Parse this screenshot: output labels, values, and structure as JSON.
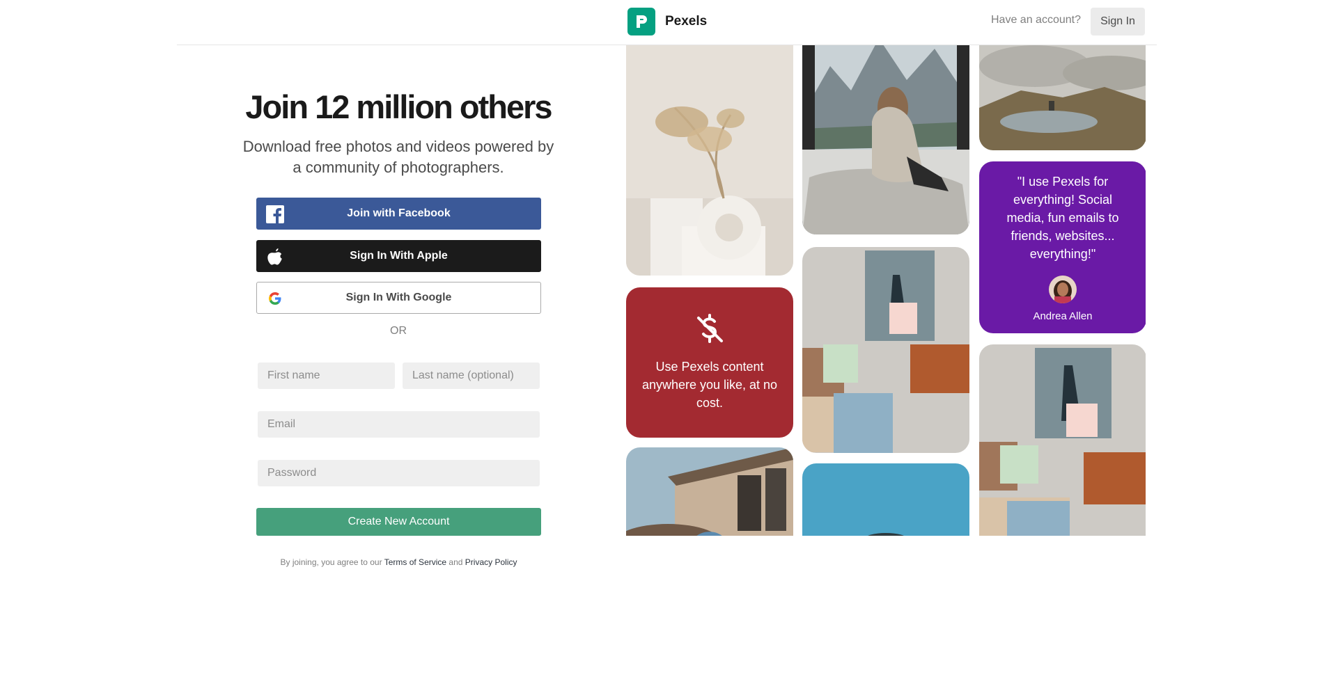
{
  "header": {
    "brand": "Pexels",
    "have_account": "Have an account?",
    "sign_in": "Sign In"
  },
  "hero": {
    "title": "Join 12 million others",
    "subtitle": "Download free photos and videos powered by a community of photographers."
  },
  "social": {
    "facebook": "Join with Facebook",
    "apple": "Sign In With Apple",
    "google": "Sign In With Google"
  },
  "or_label": "OR",
  "form": {
    "first_name_placeholder": "First name",
    "last_name_placeholder": "Last name (optional)",
    "email_placeholder": "Email",
    "password_placeholder": "Password",
    "submit": "Create New Account"
  },
  "legal": {
    "prefix": "By joining, you agree to our",
    "terms": "Terms of Service",
    "and": "and",
    "privacy": "Privacy Policy"
  },
  "promos": {
    "free": {
      "text": "Use Pexels content anywhere you like, at no cost.",
      "icon": "no-dollar-icon",
      "color": "#a32a31"
    },
    "testimonial": {
      "quote": "\"I use Pexels for everything! Social media, fun emails to friends, websites... everything!\"",
      "author": "Andrea Allen",
      "color": "#6a1aa6"
    }
  },
  "colors": {
    "brand": "#05a081",
    "facebook": "#3b5998",
    "apple": "#1b1b1b",
    "create_button": "#46a07c"
  }
}
